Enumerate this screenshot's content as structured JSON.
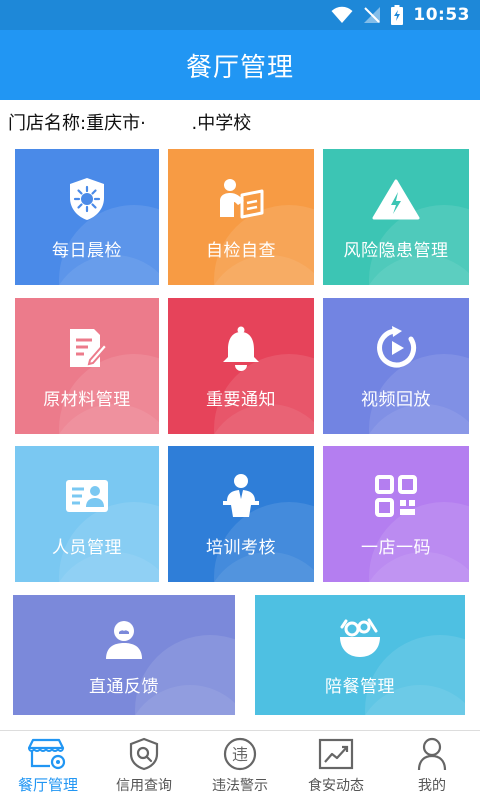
{
  "status_bar": {
    "time": "10:53"
  },
  "header": {
    "title": "餐厅管理"
  },
  "store": {
    "label": "门店名称:重庆市·        .中学校"
  },
  "tiles": [
    {
      "label": "每日晨检",
      "icon": "shield-virus-icon"
    },
    {
      "label": "自检自查",
      "icon": "person-writing-icon"
    },
    {
      "label": "风险隐患管理",
      "icon": "warning-bolt-icon"
    },
    {
      "label": "原材料管理",
      "icon": "document-edit-icon"
    },
    {
      "label": "重要通知",
      "icon": "bell-icon"
    },
    {
      "label": "视频回放",
      "icon": "video-replay-icon"
    },
    {
      "label": "人员管理",
      "icon": "id-card-icon"
    },
    {
      "label": "培训考核",
      "icon": "lecturer-icon"
    },
    {
      "label": "一店一码",
      "icon": "qr-code-icon"
    },
    {
      "label": "直通反馈",
      "icon": "user-feedback-icon"
    },
    {
      "label": "陪餐管理",
      "icon": "salad-bowl-icon"
    }
  ],
  "nav": [
    {
      "label": "餐厅管理",
      "icon": "store-gear-icon",
      "active": true
    },
    {
      "label": "信用查询",
      "icon": "shield-search-icon",
      "active": false
    },
    {
      "label": "违法警示",
      "icon": "violation-icon",
      "active": false
    },
    {
      "label": "食安动态",
      "icon": "trend-chart-icon",
      "active": false
    },
    {
      "label": "我的",
      "icon": "person-icon",
      "active": false
    }
  ],
  "colors": {
    "primary": "#2196f3",
    "status_bar": "#1e88d8",
    "tiles": [
      "#4a8ae8",
      "#f79b44",
      "#3cc5b4",
      "#ec7b8b",
      "#e6435a",
      "#7284e2",
      "#7ac8f2",
      "#2f7ed8",
      "#b47ef0",
      "#7b89da",
      "#4ec0e2"
    ]
  }
}
